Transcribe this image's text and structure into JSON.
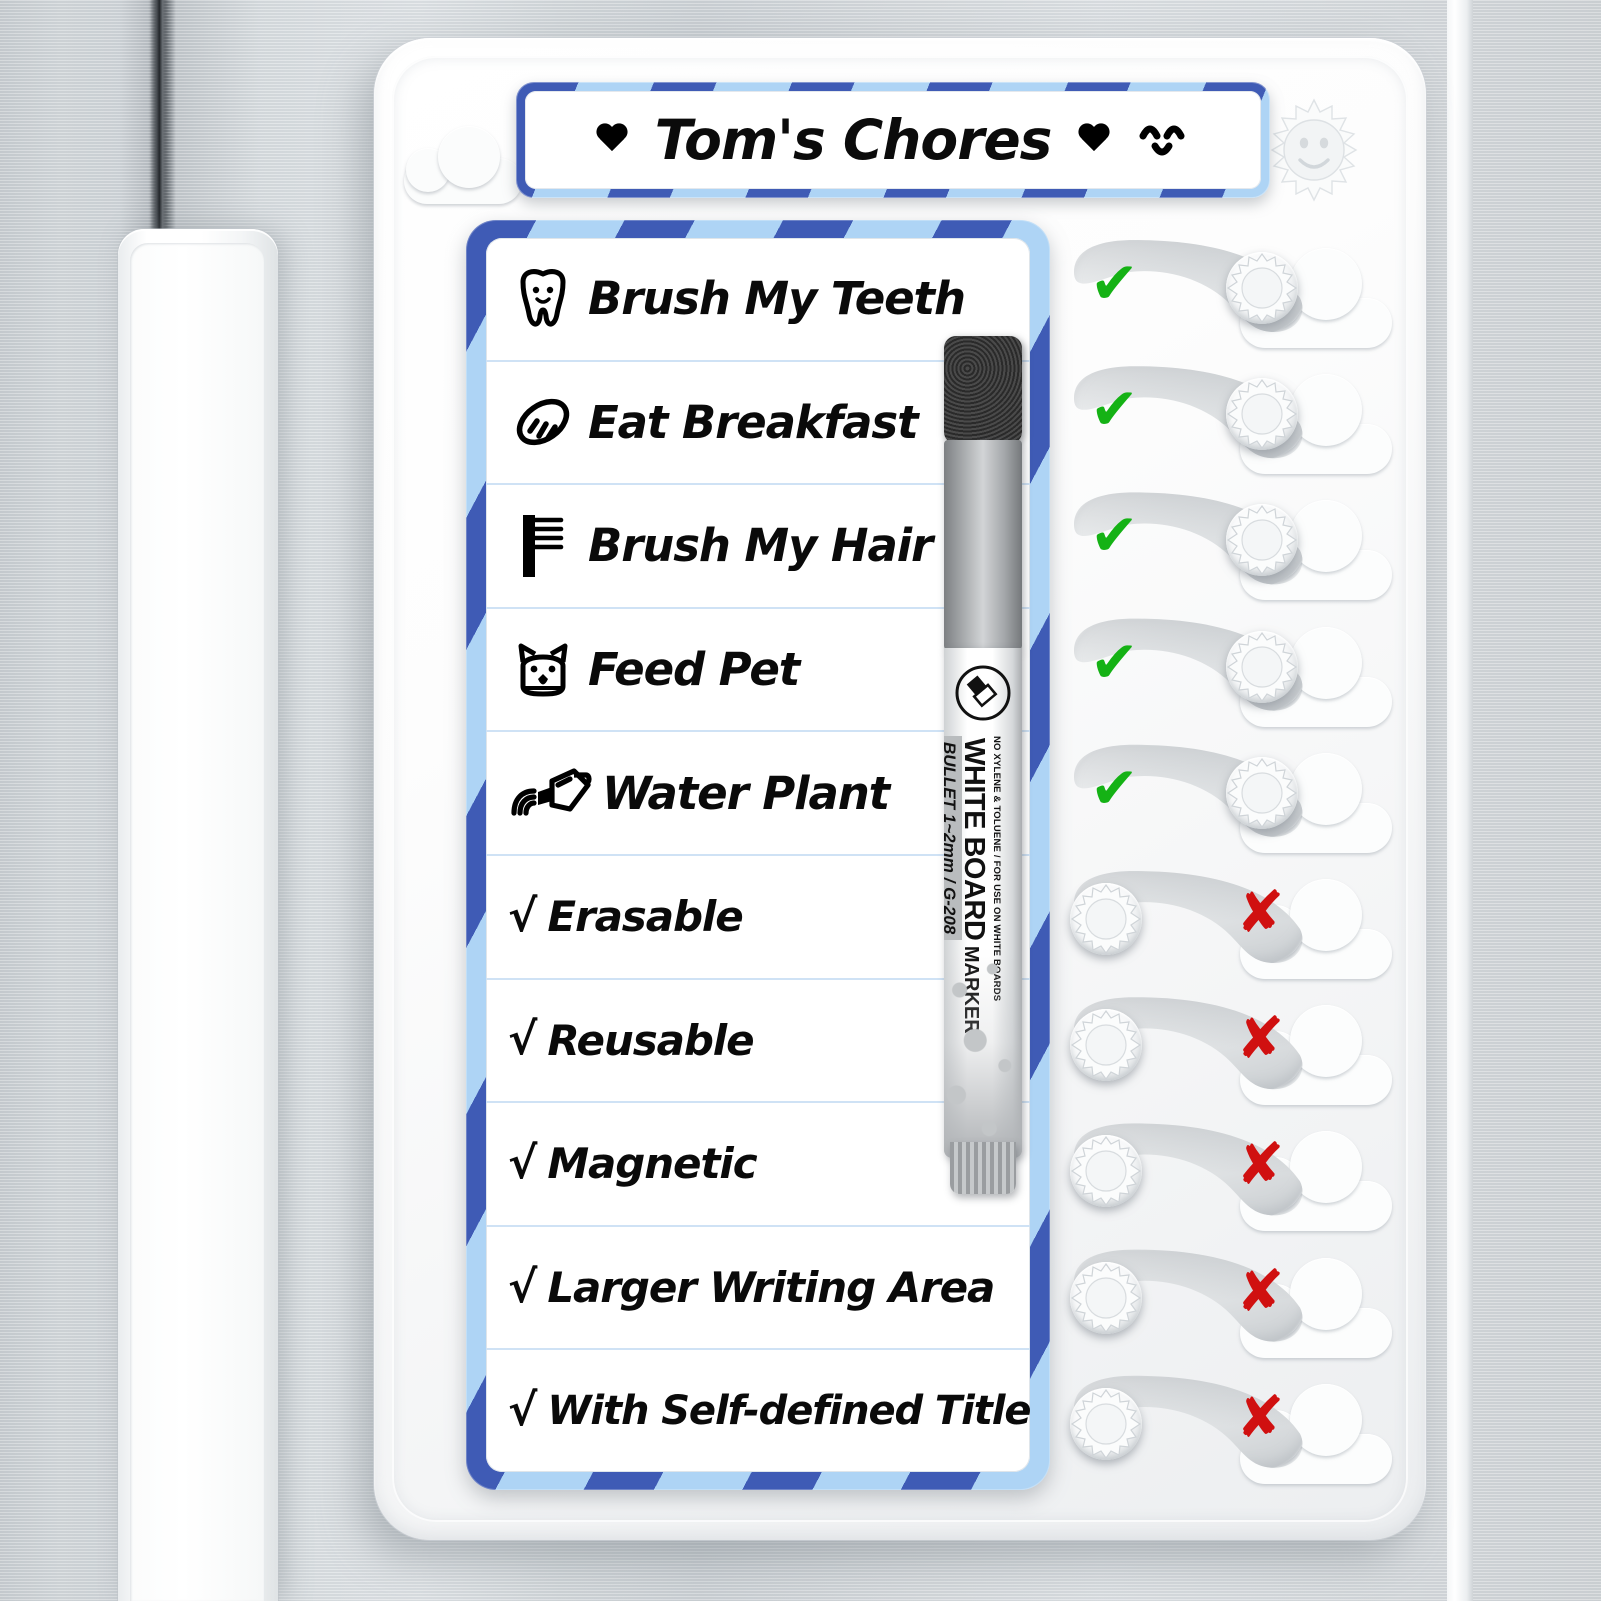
{
  "scene": {
    "surface": "stainless-steel-refrigerator-door",
    "product": "magnetic-dry-erase-chore-chart-board"
  },
  "title_bar": {
    "title": "Tom's Chores",
    "left_icon": "heart-icon",
    "right_icon": "heart-icon",
    "face_icon": "happy-face-icon",
    "stripe_dark": "#3f5bb5",
    "stripe_light": "#aed4f5"
  },
  "decorations": {
    "cloud_left": "cloud-icon",
    "sun": "smiling-sun-icon"
  },
  "list": {
    "rows": [
      {
        "icon": "tooth-icon",
        "check": "",
        "label": "Brush My Teeth"
      },
      {
        "icon": "bread-icon",
        "check": "",
        "label": "Eat Breakfast"
      },
      {
        "icon": "comb-icon",
        "check": "",
        "label": "Brush My Hair"
      },
      {
        "icon": "pet-face-icon",
        "check": "",
        "label": "Feed Pet"
      },
      {
        "icon": "watering-can-icon",
        "check": "",
        "label": "Water Plant"
      },
      {
        "icon": "",
        "check": "√",
        "label": "Erasable"
      },
      {
        "icon": "",
        "check": "√",
        "label": "Reusable"
      },
      {
        "icon": "",
        "check": "√",
        "label": "Magnetic"
      },
      {
        "icon": "",
        "check": "√",
        "label": "Larger Writing Area"
      },
      {
        "icon": "",
        "check": "√",
        "label": "With Self-defined Title"
      }
    ]
  },
  "sliders": {
    "check_color": "#15b215",
    "cross_color": "#d01010",
    "states": [
      {
        "mark": "✔",
        "state": "done",
        "knob_side": "right"
      },
      {
        "mark": "✔",
        "state": "done",
        "knob_side": "right"
      },
      {
        "mark": "✔",
        "state": "done",
        "knob_side": "right"
      },
      {
        "mark": "✔",
        "state": "done",
        "knob_side": "right"
      },
      {
        "mark": "✔",
        "state": "done",
        "knob_side": "right"
      },
      {
        "mark": "✘",
        "state": "not-done",
        "knob_side": "left"
      },
      {
        "mark": "✘",
        "state": "not-done",
        "knob_side": "left"
      },
      {
        "mark": "✘",
        "state": "not-done",
        "knob_side": "left"
      },
      {
        "mark": "✘",
        "state": "not-done",
        "knob_side": "left"
      },
      {
        "mark": "✘",
        "state": "not-done",
        "knob_side": "left"
      }
    ]
  },
  "marker": {
    "cap_color": "#2e2e2e",
    "barrel_color": "#9a9da0",
    "line1": "NO XYLENE & TOLUENE / FOR USE ON WHITE BOARDS",
    "line2_bold": "WHITE BOARD",
    "line2_rest": " MARKER",
    "line3": "BULLET 1~2mm",
    "line4": "G-208",
    "nib_icon": "marker-nib-icon"
  }
}
